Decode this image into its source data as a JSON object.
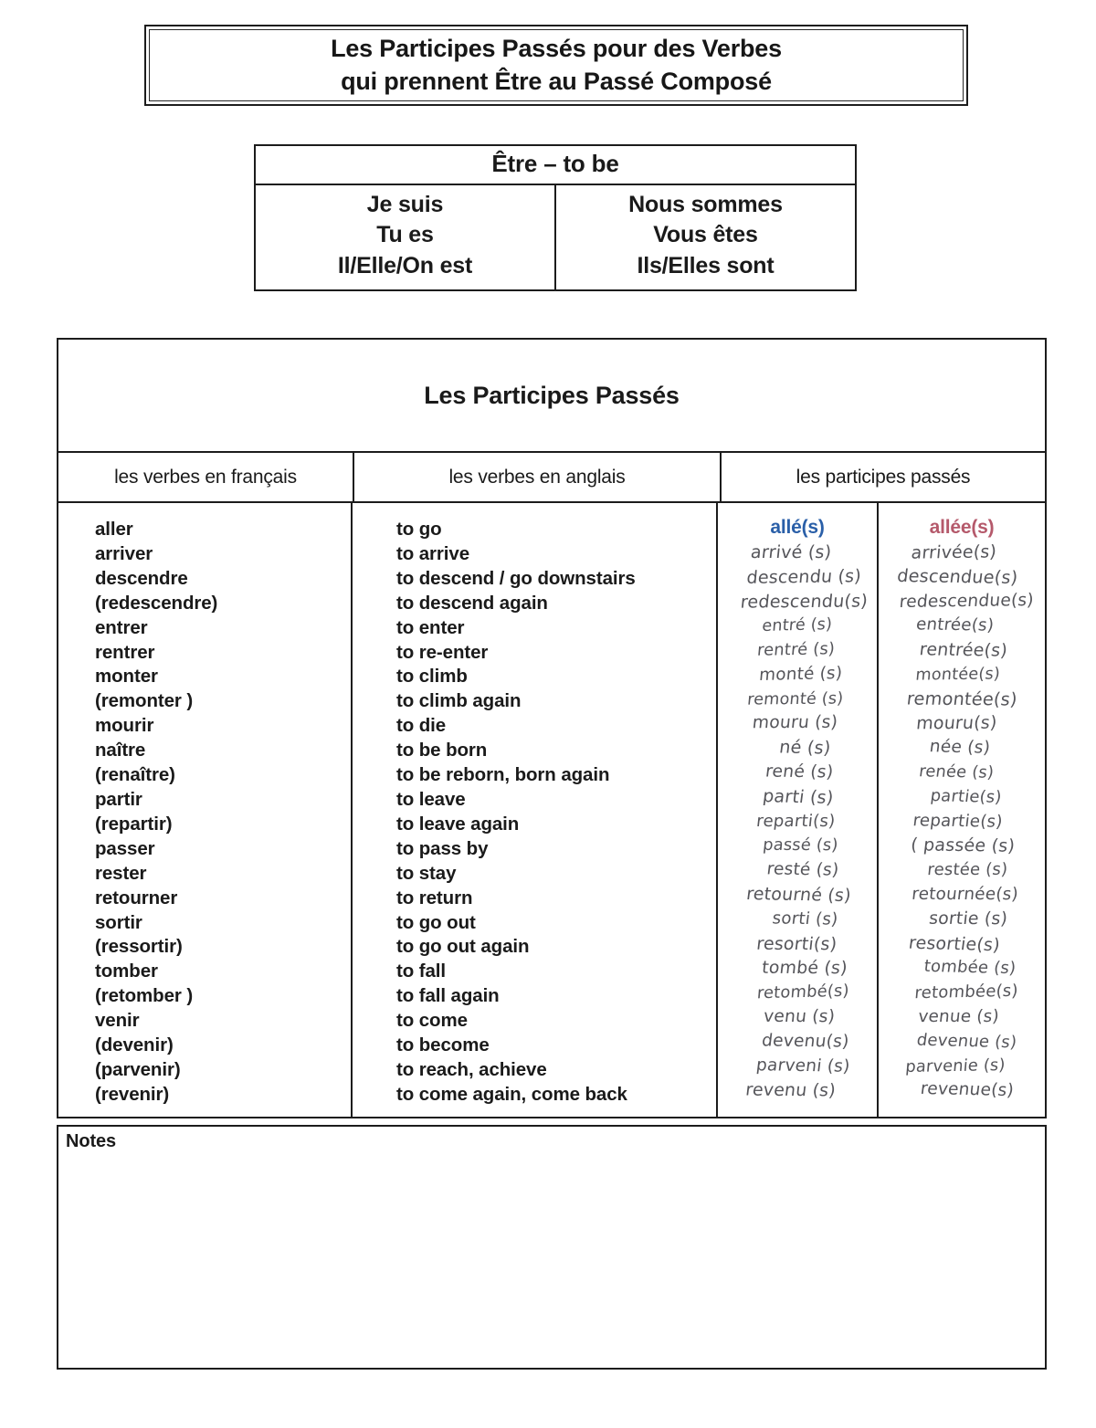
{
  "title": {
    "line1": "Les Participes Passés pour des Verbes",
    "line2": "qui prennent Être au Passé Composé"
  },
  "etre_table": {
    "heading": "Être – to be",
    "left_column": [
      "Je suis",
      "Tu es",
      "Il/Elle/On est"
    ],
    "right_column": [
      "Nous sommes",
      "Vous êtes",
      "Ils/Elles sont"
    ]
  },
  "main_table": {
    "band_title": "Les Participes Passés",
    "headers": {
      "french": "les verbes en français",
      "english": "les verbes en anglais",
      "participles": "les participes passés"
    },
    "participle_column_headings": {
      "masculine": "allé(s)",
      "feminine": "allée(s)"
    },
    "colors": {
      "masculine_accent": "#2a5fa8",
      "feminine_accent": "#b5596b",
      "handwriting": "#55555a",
      "rule": "#1c1c1c"
    },
    "rows": [
      {
        "french": "aller",
        "english": "to go",
        "masculine": "",
        "feminine": ""
      },
      {
        "french": "arriver",
        "english": "to arrive",
        "masculine": "arrivé (s)",
        "feminine": "arrivée(s)"
      },
      {
        "french": "descendre",
        "english": "to descend / go downstairs",
        "masculine": "descendu (s)",
        "feminine": "descendue(s)"
      },
      {
        "french": "(redescendre)",
        "english": "to descend again",
        "masculine": "redescendu(s)",
        "feminine": "redescendue(s)"
      },
      {
        "french": "entrer",
        "english": "to enter",
        "masculine": "entré (s)",
        "feminine": "entrée(s)"
      },
      {
        "french": "rentrer",
        "english": "to re-enter",
        "masculine": "rentré (s)",
        "feminine": "rentrée(s)"
      },
      {
        "french": "monter",
        "english": "to climb",
        "masculine": "monté (s)",
        "feminine": "montée(s)"
      },
      {
        "french": "(remonter )",
        "english": "to climb again",
        "masculine": "remonté (s)",
        "feminine": "remontée(s)"
      },
      {
        "french": "mourir",
        "english": "to die",
        "masculine": "mouru (s)",
        "feminine": "mouru(s)"
      },
      {
        "french": "naître",
        "english": "to be born",
        "masculine": "né (s)",
        "feminine": "née (s)"
      },
      {
        "french": "(renaître)",
        "english": "to be reborn, born again",
        "masculine": "rené (s)",
        "feminine": "renée (s)"
      },
      {
        "french": "partir",
        "english": "to leave",
        "masculine": "parti (s)",
        "feminine": "partie(s)"
      },
      {
        "french": "(repartir)",
        "english": "to leave again",
        "masculine": "reparti(s)",
        "feminine": "repartie(s)"
      },
      {
        "french": "passer",
        "english": "to pass by",
        "masculine": "passé (s)",
        "feminine": "( passée (s)"
      },
      {
        "french": "rester",
        "english": "to stay",
        "masculine": "resté (s)",
        "feminine": "restée (s)"
      },
      {
        "french": "retourner",
        "english": "to return",
        "masculine": "retourné (s)",
        "feminine": "retournée(s)"
      },
      {
        "french": "sortir",
        "english": "to go out",
        "masculine": "sorti (s)",
        "feminine": "sortie (s)"
      },
      {
        "french": "(ressortir)",
        "english": "to go out again",
        "masculine": "resorti(s)",
        "feminine": "resortie(s)"
      },
      {
        "french": "tomber",
        "english": "to fall",
        "masculine": "tombé (s)",
        "feminine": "tombée (s)"
      },
      {
        "french": "(retomber )",
        "english": "to fall again",
        "masculine": "retombé(s)",
        "feminine": "retombée(s)"
      },
      {
        "french": "venir",
        "english": "to come",
        "masculine": "venu (s)",
        "feminine": "venue (s)"
      },
      {
        "french": "(devenir)",
        "english": "to become",
        "masculine": "devenu(s)",
        "feminine": "devenue (s)"
      },
      {
        "french": "(parvenir)",
        "english": "to reach, achieve",
        "masculine": "parveni (s)",
        "feminine": "parvenie (s)"
      },
      {
        "french": "(revenir)",
        "english": "to come again, come back",
        "masculine": "revenu (s)",
        "feminine": "revenue(s)"
      }
    ]
  },
  "notes": {
    "label": "Notes"
  }
}
